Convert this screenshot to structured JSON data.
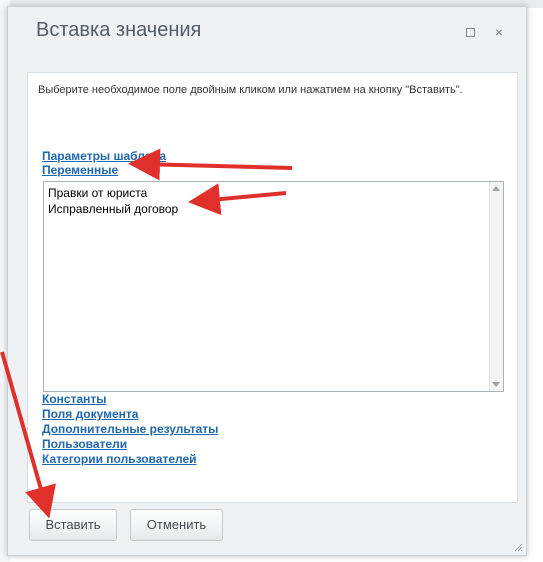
{
  "dialog": {
    "title": "Вставка значения",
    "maximize_icon": "maximize-icon",
    "close_icon": "close-icon",
    "close_glyph": "×"
  },
  "hint": "Выберите необходимое поле двойным кликом или нажатием на кнопку \"Вставить\".",
  "groups_top": [
    {
      "label": "Параметры шаблона"
    },
    {
      "label": "Переменные"
    }
  ],
  "variables_list": [
    "Правки от юриста",
    "Исправленный договор"
  ],
  "groups_bottom": [
    {
      "label": "Константы"
    },
    {
      "label": "Поля документа"
    },
    {
      "label": "Дополнительные результаты"
    },
    {
      "label": "Пользователи"
    },
    {
      "label": "Категории пользователей"
    }
  ],
  "buttons": {
    "insert": "Вставить",
    "cancel": "Отменить"
  },
  "colors": {
    "link": "#2067b0",
    "annotation_arrow": "#e0302b",
    "dialog_bg": "#eef2f4"
  }
}
